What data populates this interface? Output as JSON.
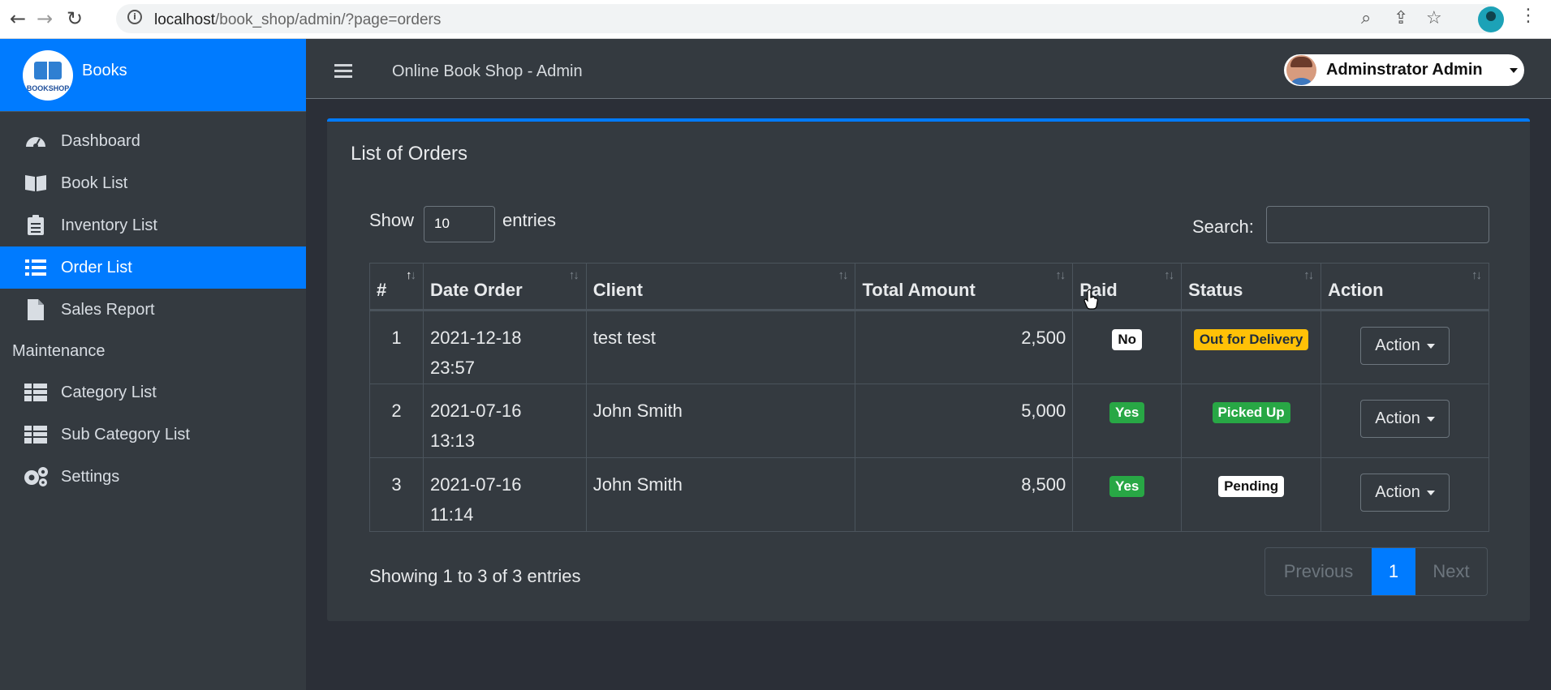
{
  "browser": {
    "url_host": "localhost",
    "url_path": "/book_shop/admin/?page=orders",
    "icons": [
      "back-icon",
      "forward-icon",
      "reload-icon",
      "info-icon",
      "zoom-icon",
      "share-icon",
      "star-icon",
      "profile-icon",
      "menu-dots-icon"
    ]
  },
  "sidebar": {
    "brand": "Books",
    "logo_text": "BOOKSHOP",
    "items": [
      {
        "label": "Dashboard",
        "icon": "dashboard-icon",
        "active": false
      },
      {
        "label": "Book List",
        "icon": "book-icon",
        "active": false
      },
      {
        "label": "Inventory List",
        "icon": "clipboard-icon",
        "active": false
      },
      {
        "label": "Order List",
        "icon": "list-icon",
        "active": true
      },
      {
        "label": "Sales Report",
        "icon": "file-icon",
        "active": false
      }
    ],
    "section": "Maintenance",
    "maintenance_items": [
      {
        "label": "Category List",
        "icon": "table-icon"
      },
      {
        "label": "Sub Category List",
        "icon": "table-icon"
      },
      {
        "label": "Settings",
        "icon": "gears-icon"
      }
    ]
  },
  "topbar": {
    "title": "Online Book Shop - Admin",
    "user_name": "Adminstrator Admin"
  },
  "main": {
    "card_title": "List of Orders",
    "show_label": "Show",
    "entries_value": "10",
    "entries_label": "entries",
    "search_label": "Search:",
    "search_value": "",
    "columns": [
      "#",
      "Date Order",
      "Client",
      "Total Amount",
      "Paid",
      "Status",
      "Action"
    ],
    "rows": [
      {
        "num": "1",
        "date": "2021-12-18",
        "time": "23:57",
        "client": "test test",
        "amount": "2,500",
        "paid": "No",
        "status": "Out for Delivery",
        "action": "Action"
      },
      {
        "num": "2",
        "date": "2021-07-16",
        "time": "13:13",
        "client": "John Smith",
        "amount": "5,000",
        "paid": "Yes",
        "status": "Picked Up",
        "action": "Action"
      },
      {
        "num": "3",
        "date": "2021-07-16",
        "time": "11:14",
        "client": "John Smith",
        "amount": "8,500",
        "paid": "Yes",
        "status": "Pending",
        "action": "Action"
      }
    ],
    "info": "Showing 1 to 3 of 3 entries",
    "pagination": {
      "previous": "Previous",
      "current": "1",
      "next": "Next"
    }
  },
  "colors": {
    "primary": "#007bff",
    "success": "#28a745",
    "warning": "#ffc107",
    "sidebar": "#343a40"
  }
}
